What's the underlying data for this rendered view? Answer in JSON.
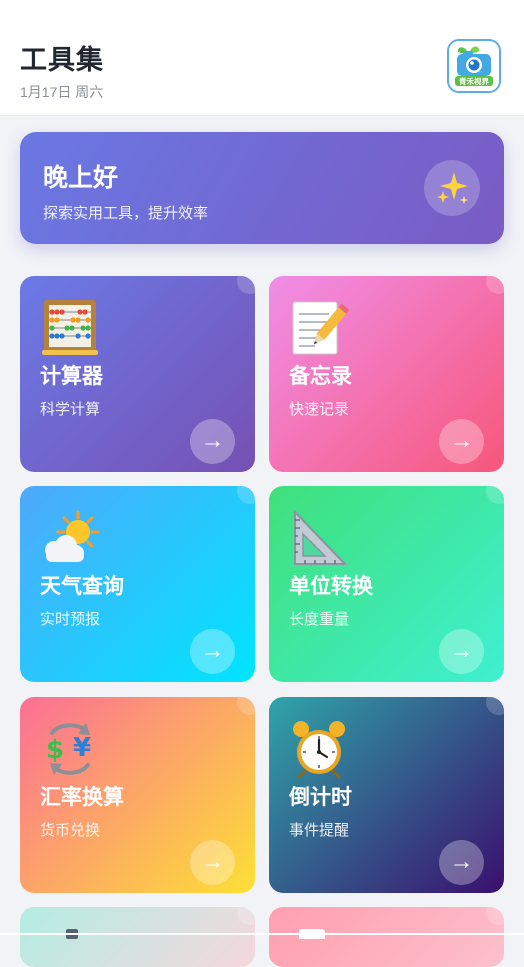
{
  "header": {
    "title": "工具集",
    "date": "1月17日 周六",
    "logo_text": "青禾视界"
  },
  "greeting": {
    "title": "晚上好",
    "subtitle": "探索实用工具，提升效率",
    "icon": "sparkles-icon"
  },
  "tools": [
    {
      "name": "计算器",
      "desc": "科学计算",
      "icon": "abacus-icon"
    },
    {
      "name": "备忘录",
      "desc": "快速记录",
      "icon": "memo-icon"
    },
    {
      "name": "天气查询",
      "desc": "实时预报",
      "icon": "sun-cloud-icon"
    },
    {
      "name": "单位转换",
      "desc": "长度重量",
      "icon": "triangle-ruler-icon"
    },
    {
      "name": "汇率换算",
      "desc": "货币兑换",
      "icon": "currency-exchange-icon"
    },
    {
      "name": "倒计时",
      "desc": "事件提醒",
      "icon": "alarm-clock-icon"
    }
  ],
  "colors": {
    "greeting": [
      "#6a78e3",
      "#7a5bc4"
    ],
    "calculator": [
      "#6b7ae6",
      "#7651b4"
    ],
    "memo": [
      "#f08ee8",
      "#f7577a"
    ],
    "weather": [
      "#4fa9fb",
      "#00e5fe"
    ],
    "unit": [
      "#3fe07a",
      "#3ff0d2"
    ],
    "exchange": [
      "#fc6f96",
      "#fde035"
    ],
    "countdown": [
      "#2fa5a8",
      "#3a0f6e"
    ]
  },
  "arrow_glyph": "→"
}
